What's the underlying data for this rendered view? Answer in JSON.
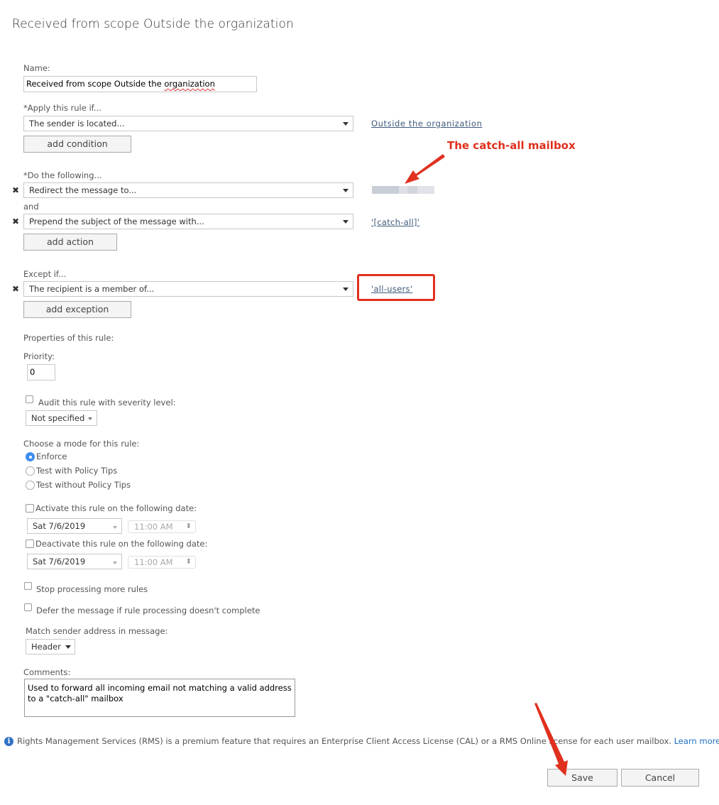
{
  "page": {
    "title": "Received from scope Outside the organization"
  },
  "name_field": {
    "label": "Name:",
    "value_prefix": "Received from scope Outside the ",
    "value_misspelled": "organization"
  },
  "conditions": {
    "label": "*Apply this rule if...",
    "items": [
      {
        "value": "The sender is located...",
        "link": "Outside the organization"
      }
    ],
    "add_label": "add condition"
  },
  "actions": {
    "label": "*Do the following...",
    "joiner": "and",
    "items": [
      {
        "value": "Redirect the message to...",
        "link": ""
      },
      {
        "value": "Prepend the subject of the message with...",
        "link": "'[catch-all]'"
      }
    ],
    "add_label": "add action"
  },
  "exceptions": {
    "label": "Except if...",
    "items": [
      {
        "value": "The recipient is a member of...",
        "link": "'all-users'"
      }
    ],
    "add_label": "add exception"
  },
  "properties": {
    "heading": "Properties of this rule:",
    "priority_label": "Priority:",
    "priority_value": "0",
    "audit": {
      "label": "Audit this rule with severity level:",
      "checked": false,
      "severity": "Not specified"
    },
    "mode": {
      "label": "Choose a mode for this rule:",
      "options": [
        {
          "label": "Enforce",
          "selected": true
        },
        {
          "label": "Test with Policy Tips",
          "selected": false
        },
        {
          "label": "Test without Policy Tips",
          "selected": false
        }
      ]
    },
    "activate": {
      "label": "Activate this rule on the following date:",
      "checked": false,
      "date": "Sat 7/6/2019",
      "time": "11:00 AM"
    },
    "deactivate": {
      "label": "Deactivate this rule on the following date:",
      "checked": false,
      "date": "Sat 7/6/2019",
      "time": "11:00 AM"
    },
    "stop_processing": {
      "label": "Stop processing more rules",
      "checked": false
    },
    "defer": {
      "label": "Defer the message if rule processing doesn't complete",
      "checked": false
    },
    "match_sender": {
      "label": "Match sender address in message:",
      "value": "Header"
    },
    "comments": {
      "label": "Comments:",
      "value": "Used to forward all incoming email not matching a valid address to a \"catch-all\" mailbox"
    }
  },
  "rms_notice": {
    "icon": "info-icon",
    "text": "Rights Management Services (RMS) is a premium feature that requires an Enterprise Client Access License (CAL) or a RMS Online license for each user mailbox.",
    "link": "Learn more"
  },
  "footer": {
    "save_label": "Save",
    "cancel_label": "Cancel"
  },
  "annotations": {
    "callout_text": "The catch-all mailbox",
    "color": "#e0301e"
  }
}
